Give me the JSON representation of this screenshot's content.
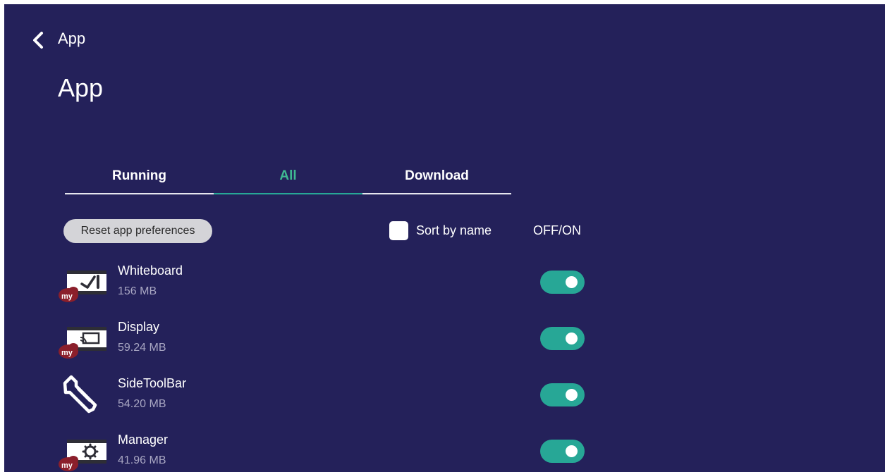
{
  "header": {
    "back_icon": "chevron-left-icon",
    "title": "App"
  },
  "page": {
    "title": "App"
  },
  "tabs": [
    {
      "label": "Running",
      "active": false
    },
    {
      "label": "All",
      "active": true
    },
    {
      "label": "Download",
      "active": false
    }
  ],
  "toolbar": {
    "reset_label": "Reset app preferences",
    "sort_label": "Sort by name",
    "sort_checked": false,
    "column_label": "OFF/ON"
  },
  "apps": [
    {
      "name": "Whiteboard",
      "size": "156 MB",
      "icon": "whiteboard-app-icon",
      "badge": "my",
      "enabled": true
    },
    {
      "name": "Display",
      "size": "59.24 MB",
      "icon": "display-cast-app-icon",
      "badge": "my",
      "enabled": true
    },
    {
      "name": "SideToolBar",
      "size": "54.20 MB",
      "icon": "wrench-icon",
      "enabled": true
    },
    {
      "name": "Manager",
      "size": "41.96 MB",
      "icon": "manager-gear-app-icon",
      "badge": "my",
      "enabled": true
    }
  ],
  "colors": {
    "background": "#24215a",
    "accent": "#27a796",
    "badge": "#8b1f2b",
    "secondary_text": "#a8a6c2"
  }
}
